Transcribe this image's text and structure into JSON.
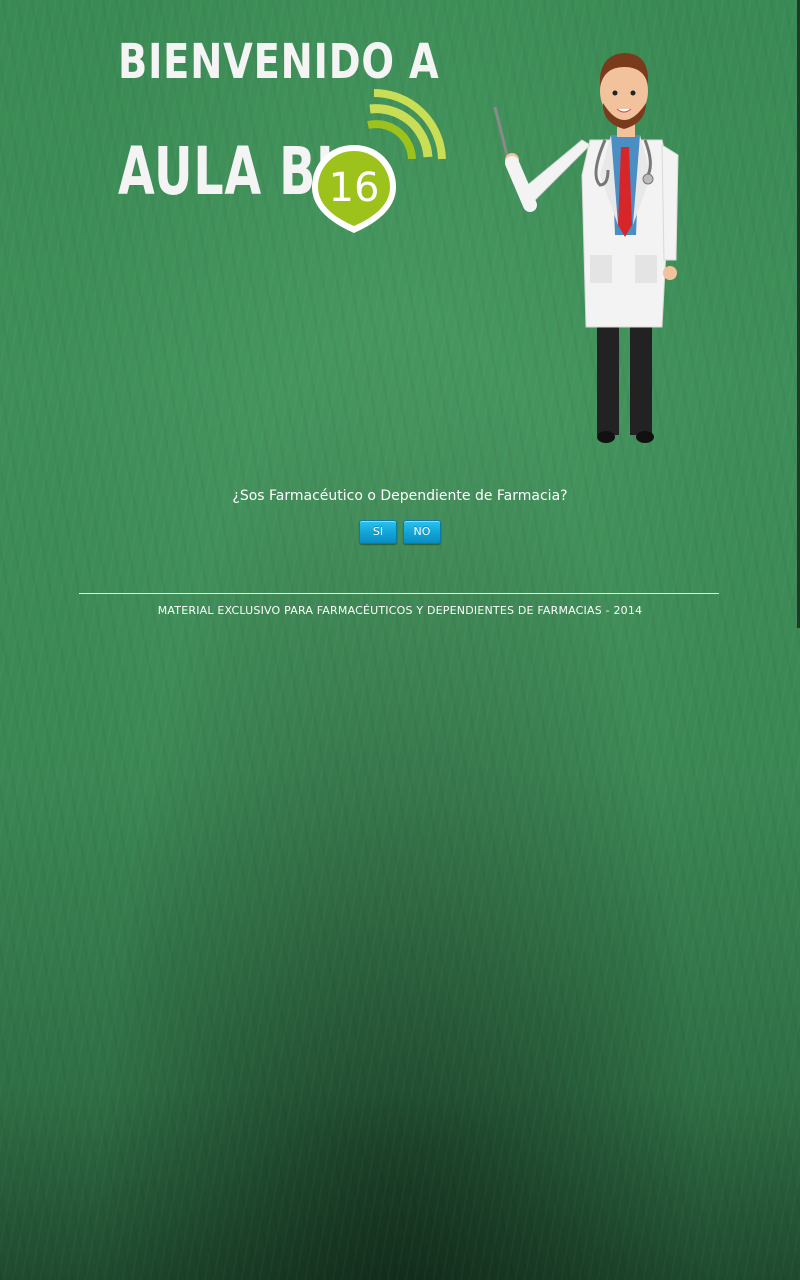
{
  "logo": {
    "line1": "BIENVENIDO A",
    "line2": "AULA BI",
    "badge_number": "16",
    "colors": {
      "text": "#f4f4f4",
      "badge_green": "#9cc21b",
      "badge_light": "#c9dd55"
    }
  },
  "illustration": {
    "name": "doctor-with-pointer"
  },
  "prompt": {
    "question": "¿Sos Farmacéutico o Dependiente de Farmacia?",
    "yes_label": "SI",
    "no_label": "NO"
  },
  "footer": {
    "text": "MATERIAL EXCLUSIVO PARA FARMACÉUTICOS Y DEPENDIENTES DE FARMACIAS - 2014"
  },
  "colors": {
    "background": "#3b8754",
    "button": "#13a6d9",
    "text": "#ffffff"
  }
}
